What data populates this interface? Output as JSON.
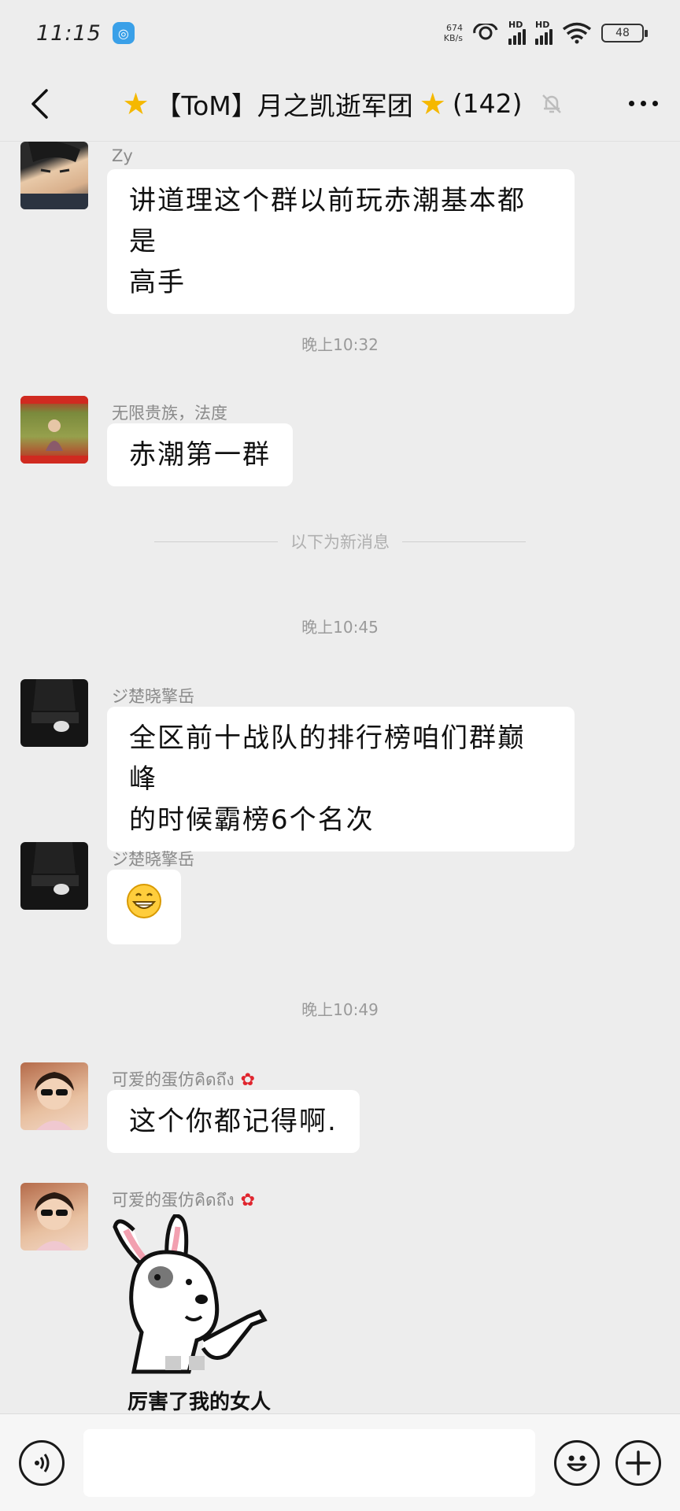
{
  "status_bar": {
    "time": "11:15",
    "net_speed_value": "674",
    "net_speed_unit": "KB/s",
    "hd_label_1": "HD",
    "hd_label_2": "HD",
    "battery": "48"
  },
  "header": {
    "title_prefix": "【ToM】月之凯逝军团",
    "member_count": "(142)"
  },
  "messages": [
    {
      "sender": "Zy",
      "text_line1": "讲道理这个群以前玩赤潮基本都是",
      "text_line2": "高手"
    },
    {
      "sender": "无限贵族，法度",
      "text_line1": "赤潮第一群"
    },
    {
      "sender": "ジ楚晓擎岳",
      "text_line1": "全区前十战队的排行榜咱们群巅峰",
      "text_line2": "的时候霸榜6个名次"
    },
    {
      "sender": "ジ楚晓擎岳",
      "emoji": "grinning-face"
    },
    {
      "sender": "可爱的蛋仿คิดถึง",
      "text_line1": "这个你都记得啊."
    },
    {
      "sender": "可爱的蛋仿คิดถึง",
      "sticker_caption": "厉害了我的女人"
    }
  ],
  "timestamps": [
    "晚上10:32",
    "晚上10:45",
    "晚上10:49"
  ],
  "new_messages_divider": "以下为新消息",
  "input": {
    "placeholder": ""
  },
  "colors": {
    "background": "#ededed",
    "bubble": "#ffffff",
    "star": "#f5b800"
  }
}
